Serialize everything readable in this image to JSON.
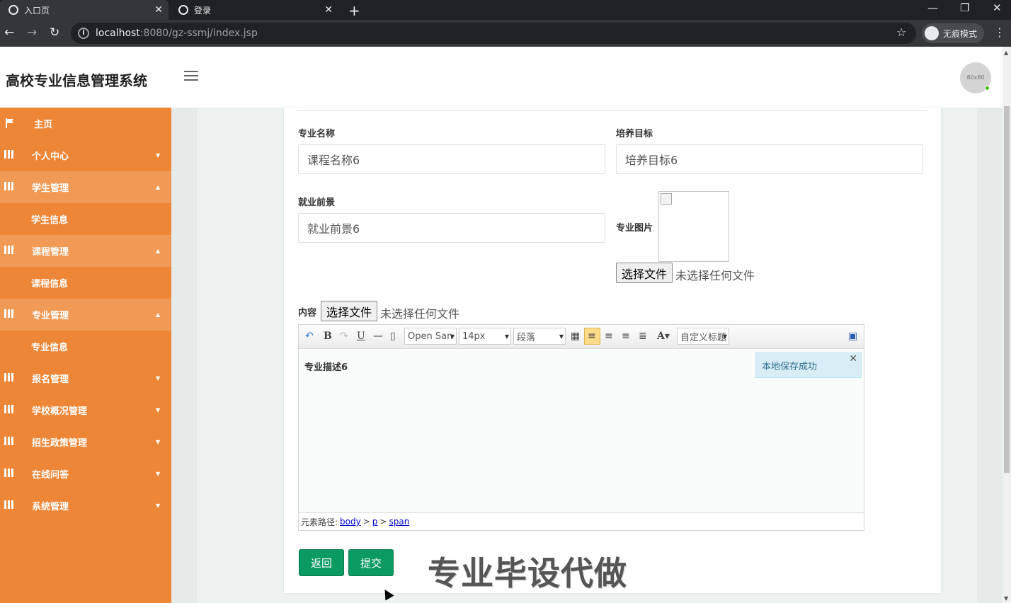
{
  "browser": {
    "tabs": [
      {
        "title": "入口页",
        "active": true
      },
      {
        "title": "登录",
        "active": false
      }
    ],
    "url_host": "localhost",
    "url_path": ":8080/gz-ssmj/index.jsp",
    "incognito_label": "无痕模式"
  },
  "header": {
    "brand": "高校专业信息管理系统",
    "avatar_text": "80x80"
  },
  "sidebar": {
    "home": "主页",
    "items": [
      {
        "label": "个人中心"
      },
      {
        "label": "学生管理"
      },
      {
        "label": "学生信息"
      },
      {
        "label": "课程管理"
      },
      {
        "label": "课程信息"
      },
      {
        "label": "专业管理"
      },
      {
        "label": "专业信息"
      },
      {
        "label": "报名管理"
      },
      {
        "label": "学校概况管理"
      },
      {
        "label": "招生政策管理"
      },
      {
        "label": "在线问答"
      },
      {
        "label": "系统管理"
      }
    ]
  },
  "form": {
    "major_name_label": "专业名称",
    "major_name_value": "课程名称6",
    "goal_label": "培养目标",
    "goal_value": "培养目标6",
    "prospect_label": "就业前景",
    "prospect_value": "就业前景6",
    "image_label": "专业图片",
    "choose_file": "选择文件",
    "no_file": "未选择任何文件",
    "content_label": "内容"
  },
  "editor": {
    "font_family": "Open San",
    "font_size": "14px",
    "paragraph": "段落",
    "custom_title": "自定义标题",
    "text": "专业描述6",
    "toast": "本地保存成功",
    "path_label": "元素路径:",
    "path": [
      "body",
      "p",
      "span"
    ]
  },
  "buttons": {
    "back": "返回",
    "submit": "提交"
  },
  "watermark": "专业毕设代做"
}
